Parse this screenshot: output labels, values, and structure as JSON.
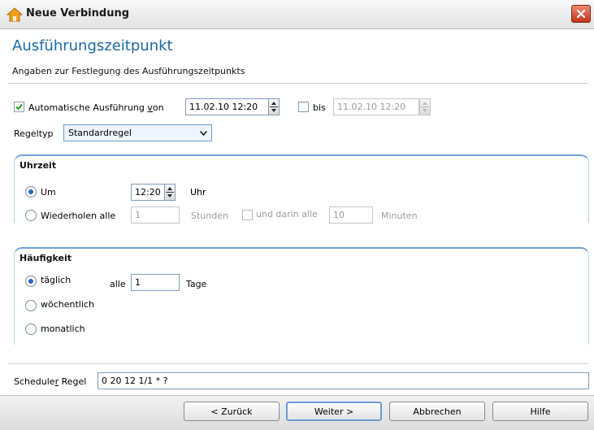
{
  "window": {
    "title": "Neue Verbindung"
  },
  "header": {
    "title": "Ausführungszeitpunkt",
    "subtitle": "Angaben zur Festlegung des Ausführungszeitpunkts"
  },
  "execution": {
    "auto_checked": true,
    "auto_label_prefix": "Automatische Ausführung ",
    "auto_label_underlined": "v",
    "auto_label_suffix": "on",
    "from_value": "11.02.10 12:20",
    "until_checked": false,
    "until_label": "bis",
    "until_value": "11.02.10 12:20"
  },
  "rule_type": {
    "label": "Regeltyp",
    "selected": "Standardregel"
  },
  "time_section": {
    "title": "Uhrzeit",
    "at_label": "Um",
    "at_value": "12:20",
    "at_unit": "Uhr",
    "repeat_label": "Wiederholen alle",
    "repeat_value": "1",
    "repeat_unit": "Stunden",
    "within_label": "und darin alle",
    "within_value": "10",
    "within_unit": "Minuten"
  },
  "frequency_section": {
    "title": "Häufigkeit",
    "daily_label": "täglich",
    "every_label": "alle",
    "every_value": "1",
    "every_unit": "Tage",
    "weekly_label": "wöchentlich",
    "monthly_label": "monatlich"
  },
  "scheduler": {
    "label_prefix": "Schedule",
    "label_underlined": "r",
    "label_suffix": " Regel",
    "value": "0 20 12 1/1 * ?"
  },
  "buttons": {
    "back": "< Zurück",
    "next": "Weiter >",
    "cancel": "Abbrechen",
    "help": "Hilfe"
  },
  "colors": {
    "accent": "#1c6aa1",
    "section_border": "#6fa2d8",
    "close_button": "#c6331b"
  }
}
